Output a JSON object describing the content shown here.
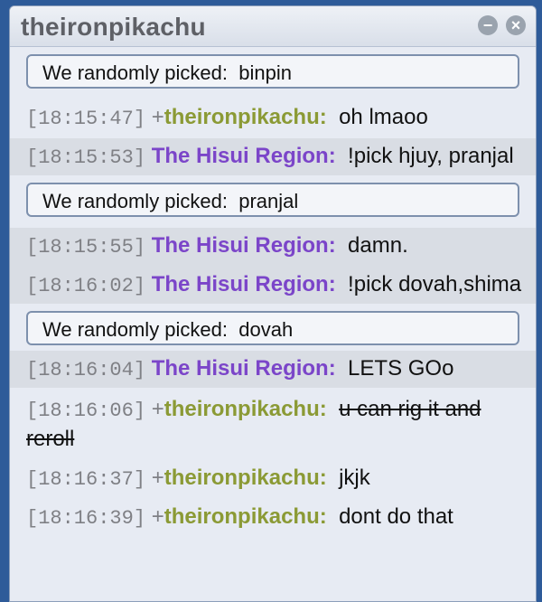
{
  "window": {
    "title": "theironpikachu",
    "minimize_glyph": "−",
    "close_glyph": "×",
    "minimize_icon": "minus-circle-icon",
    "close_icon": "close-circle-icon"
  },
  "colors": {
    "user_green": "#8b9a35",
    "user_purple": "#7b45c9",
    "highlight_row": "#d9dde4",
    "outer_background": "#2e5b99"
  },
  "log": {
    "entries": [
      {
        "kind": "notice",
        "prefix": "We randomly picked:",
        "value": "binpin"
      },
      {
        "kind": "message",
        "time": "[18:15:47]",
        "rank": "+",
        "user": "theironpikachu:",
        "text": "oh lmaoo"
      },
      {
        "kind": "message",
        "time": "[18:15:53]",
        "rank": "",
        "user": "The Hisui Region:",
        "text": "!pick hjuy, pranjal"
      },
      {
        "kind": "notice",
        "prefix": "We randomly picked:",
        "value": "pranjal"
      },
      {
        "kind": "message",
        "time": "[18:15:55]",
        "rank": "",
        "user": "The Hisui Region:",
        "text": "damn."
      },
      {
        "kind": "message",
        "time": "[18:16:02]",
        "rank": "",
        "user": "The Hisui Region:",
        "text": "!pick dovah,shima"
      },
      {
        "kind": "notice",
        "prefix": "We randomly picked:",
        "value": "dovah"
      },
      {
        "kind": "message",
        "time": "[18:16:04]",
        "rank": "",
        "user": "The Hisui Region:",
        "text": "LETS GOo"
      },
      {
        "kind": "message",
        "time": "[18:16:06]",
        "rank": "+",
        "user": "theironpikachu:",
        "text": "u can rig it and reroll"
      },
      {
        "kind": "message",
        "time": "[18:16:37]",
        "rank": "+",
        "user": "theironpikachu:",
        "text": "jkjk"
      },
      {
        "kind": "message",
        "time": "[18:16:39]",
        "rank": "+",
        "user": "theironpikachu:",
        "text": "dont do that"
      }
    ]
  }
}
